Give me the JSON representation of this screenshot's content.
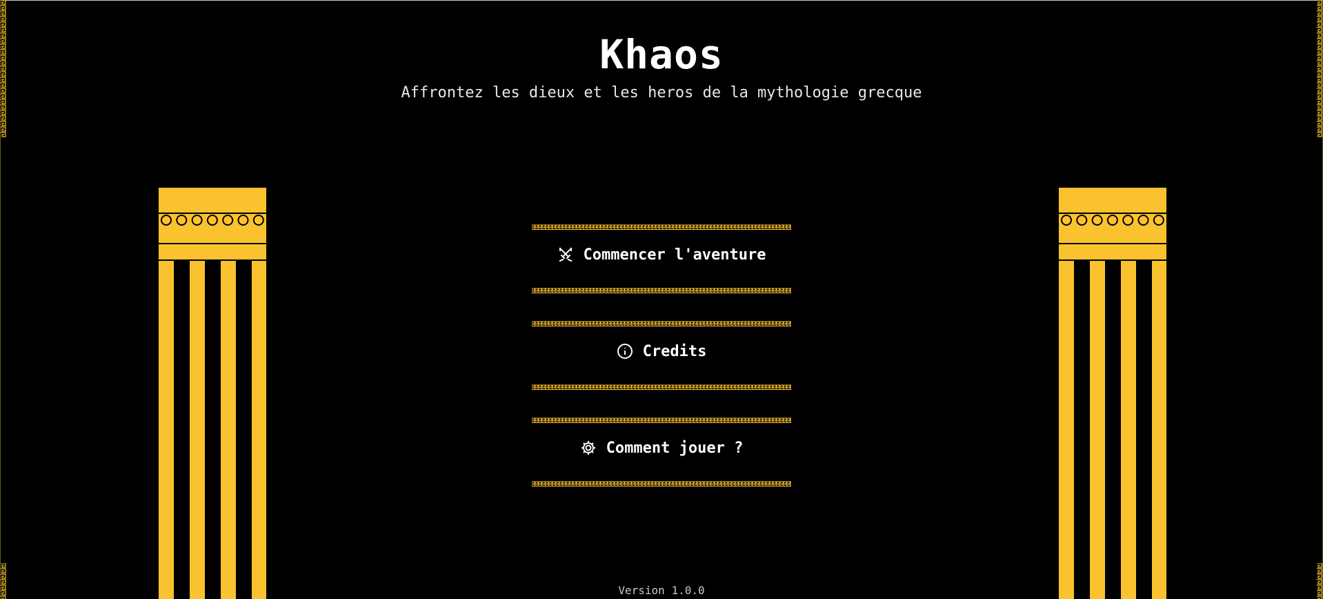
{
  "header": {
    "title": "Khaos",
    "subtitle": "Affrontez les dieux et les heros de la mythologie grecque"
  },
  "menu": {
    "items": [
      {
        "label": "Commencer l'aventure",
        "icon": "crossed-swords-icon"
      },
      {
        "label": "Credits",
        "icon": "info-icon"
      },
      {
        "label": "Comment jouer ?",
        "icon": "gear-icon"
      }
    ]
  },
  "footer": {
    "version": "Version 1.0.0"
  },
  "colors": {
    "background": "#000000",
    "accent_gold": "#F9C22E",
    "text": "#FFFFFF"
  }
}
